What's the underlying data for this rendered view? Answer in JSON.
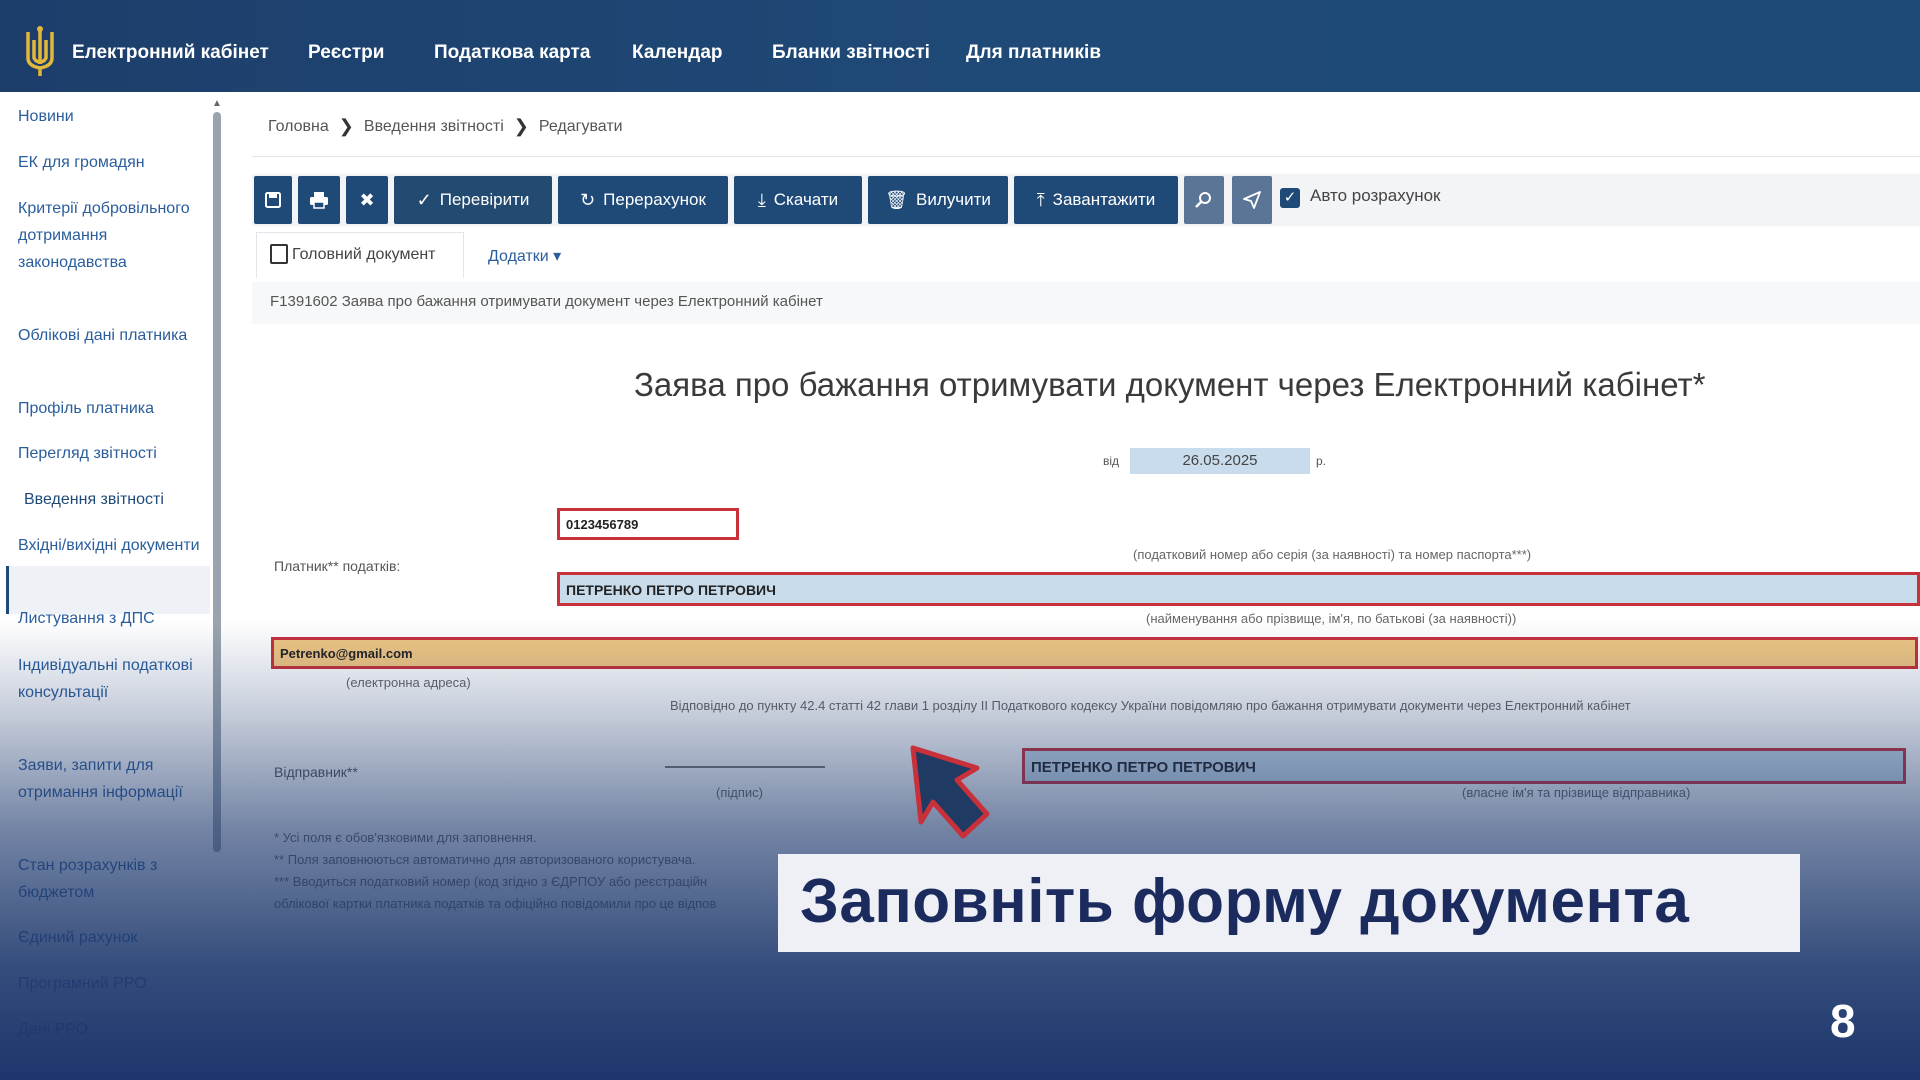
{
  "topbar": {
    "brand": "Електронний кабінет",
    "nav": [
      "Реєстри",
      "Податкова карта",
      "Календар",
      "Бланки звітності",
      "Для платників"
    ]
  },
  "sidebar": {
    "items": [
      "Новини",
      "ЕК для громадян",
      "Критерії добровільного дотримання законодавства",
      "Облікові дані платника",
      "Профіль платника",
      "Перегляд звітності",
      "Введення звітності",
      "Вхідні/вихідні документи",
      "Листування з ДПС",
      "Індивідуальні податкові консультації",
      "Заяви, запити для отримання інформації",
      "Стан розрахунків з бюджетом",
      "Єдиний рахунок",
      "Програмний РРО",
      "Дані РРО"
    ],
    "active_index": 6
  },
  "breadcrumb": [
    "Головна",
    "Введення звітності",
    "Редагувати"
  ],
  "toolbar": {
    "check": "Перевірити",
    "recalc": "Перерахунок",
    "download": "Скачати",
    "delete": "Вилучити",
    "upload": "Завантажити",
    "auto_calc": "Авто розрахунок",
    "auto_calc_checked": true
  },
  "tabs": {
    "main_doc": "Головний документ",
    "addons": "Додатки"
  },
  "doc_code_line": "F1391602 Заява про бажання отримувати документ через Електронний кабінет",
  "form": {
    "title": "Заява про бажання отримувати документ через Електронний кабінет*",
    "date_prefix": "від",
    "date": "26.05.2025",
    "date_suffix": "р.",
    "payer_label": "Платник** податків:",
    "tax_id": "0123456789",
    "tax_id_note": "(податковий номер або серія (за наявності) та номер паспорта***)",
    "name": "ПЕТРЕНКО ПЕТРО ПЕТРОВИЧ",
    "name_note": "(найменування або прізвище, ім'я, по батькові (за наявності))",
    "email": "Petrenko@gmail.com",
    "email_note": "(електронна адреса)",
    "legal_text": "Відповідно до пункту 42.4 статті 42 глави 1 розділу II Податкового кодексу України повідомляю про бажання отримувати документи через Електронний кабінет",
    "sender_label": "Відправник**",
    "signature_note": "(підпис)",
    "sender_name": "ПЕТРЕНКО ПЕТРО ПЕТРОВИЧ",
    "sender_note": "(власне ім'я та прізвище відправника)",
    "footnotes": [
      "* Усі поля є обов'язковими для заповнення.",
      "** Поля заповнюються автоматично для авторизованого користувача.",
      "*** Вводиться податковий номер (код згідно з ЄДРПОУ або реєстраційн",
      "облікової картки платника податків та офіційно повідомили про це відпов"
    ]
  },
  "caption": "Заповніть форму документа",
  "page_number": "8",
  "colors": {
    "nav_bg": "#1f4a78",
    "highlight_border": "#c8303a",
    "email_fill": "#f2c883",
    "name_fill": "#c8dceb",
    "overlay": "#1d366c"
  }
}
